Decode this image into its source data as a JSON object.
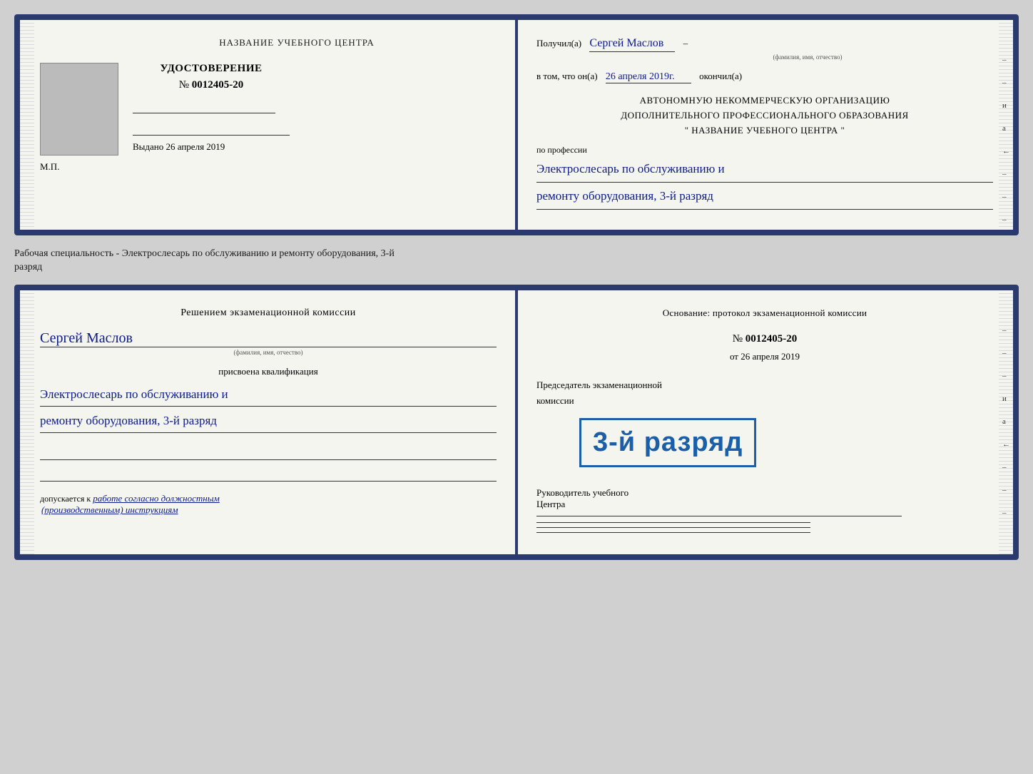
{
  "card1": {
    "left": {
      "center_title": "НАЗВАНИЕ УЧЕБНОГО ЦЕНТРА",
      "cert_label": "УДОСТОВЕРЕНИЕ",
      "cert_no_prefix": "№",
      "cert_no": "0012405-20",
      "issued_label": "Выдано",
      "issued_date": "26 апреля 2019",
      "mp_label": "М.П."
    },
    "right": {
      "received_label": "Получил(а)",
      "fio_handwritten": "Сергей Маслов",
      "fio_subtitle": "(фамилия, имя, отчество)",
      "dash": "–",
      "vtom_prefix": "в том, что он(а)",
      "vtom_date_handwritten": "26 апреля 2019г.",
      "okonchill": "окончил(а)",
      "org_line1": "АВТОНОМНУЮ НЕКОММЕРЧЕСКУЮ ОРГАНИЗАЦИЮ",
      "org_line2": "ДОПОЛНИТЕЛЬНОГО ПРОФЕССИОНАЛЬНОГО ОБРАЗОВАНИЯ",
      "org_quote_open": "\"",
      "org_name": "НАЗВАНИЕ УЧЕБНОГО ЦЕНТРА",
      "org_quote_close": "\"",
      "po_professii": "по профессии",
      "profession_line1": "Электрослесарь по обслуживанию и",
      "profession_line2": "ремонту оборудования, 3-й разряд"
    }
  },
  "between_label": {
    "line1": "Рабочая специальность - Электрослесарь по обслуживанию и ремонту оборудования, 3-й",
    "line2": "разряд"
  },
  "card2": {
    "left": {
      "title": "Решением экзаменационной комиссии",
      "fio_handwritten": "Сергей Маслов",
      "fio_subtitle": "(фамилия, имя, отчество)",
      "prisvoena": "присвоена квалификация",
      "qualification_line1": "Электрослесарь по обслуживанию и",
      "qualification_line2": "ремонту оборудования, 3-й разряд",
      "dopuskaetsya_prefix": "допускается к",
      "dopuskaetsya_val": "работе согласно должностным",
      "dopuskaetsya_val2": "(производственным) инструкциям"
    },
    "right": {
      "osnovanie_title": "Основание: протокол экзаменационной комиссии",
      "proto_no_prefix": "№",
      "proto_no": "0012405-20",
      "ot_prefix": "от",
      "ot_date": "26 апреля 2019",
      "predsedatel_label": "Председатель экзаменационной",
      "komissii_label": "комиссии",
      "stamp_text": "3-й разряд",
      "rukovoditel_label": "Руководитель учебного",
      "centra_label": "Центра"
    }
  }
}
